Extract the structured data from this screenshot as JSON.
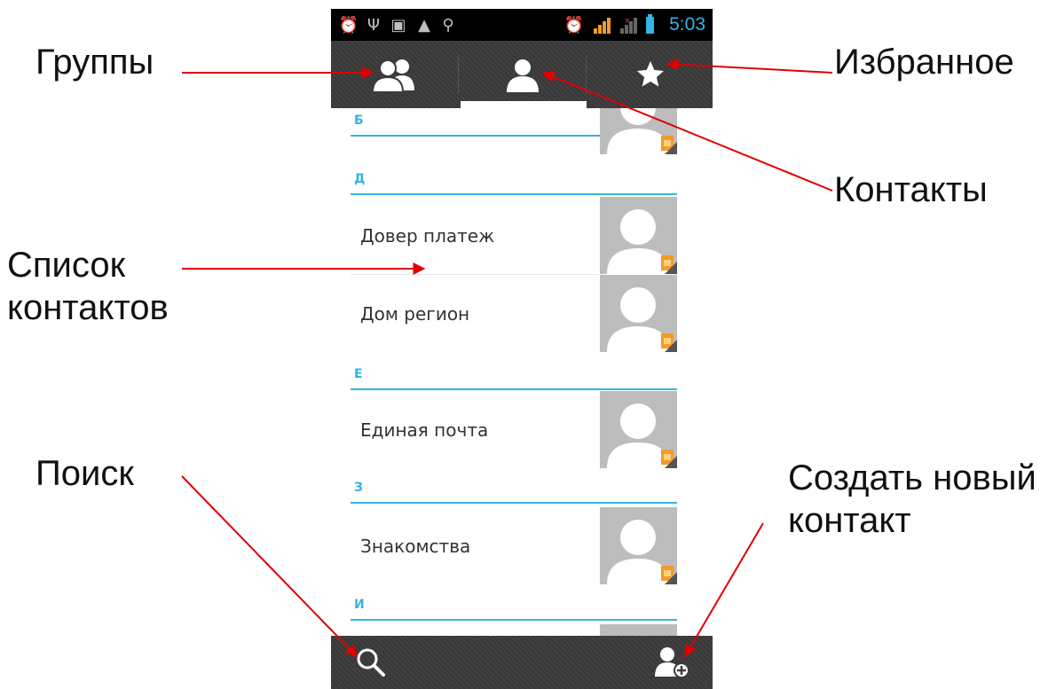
{
  "callouts": {
    "groups": "Группы",
    "favorites": "Избранное",
    "contacts": "Контакты",
    "contact_list_line1": "Список",
    "contact_list_line2": "контактов",
    "search": "Поиск",
    "new_contact_line1": "Создать новый",
    "new_contact_line2": "контакт"
  },
  "statusbar": {
    "time": "5:03",
    "icons": [
      "alarm-icon",
      "usb-icon",
      "image-icon",
      "warning-icon",
      "search-icon",
      "alarm-icon",
      "signal-icon",
      "signal-icon",
      "battery-icon"
    ]
  },
  "tabs": [
    {
      "name": "groups",
      "icon": "groups-icon"
    },
    {
      "name": "contacts",
      "icon": "person-icon",
      "selected": true
    },
    {
      "name": "favorites",
      "icon": "star-icon"
    }
  ],
  "sections": [
    {
      "letter": "Б",
      "contacts": []
    },
    {
      "letter": "Д",
      "contacts": [
        "Довер платеж",
        "Дом регион"
      ]
    },
    {
      "letter": "Е",
      "contacts": [
        "Единая почта"
      ]
    },
    {
      "letter": "З",
      "contacts": [
        "Знакомства"
      ]
    },
    {
      "letter": "И",
      "contacts": []
    }
  ],
  "bottombar": {
    "left_icon": "search-icon",
    "right_icon": "add-contact-icon"
  },
  "colors": {
    "accent": "#33b5e5",
    "bar_background": "#3b3b3b",
    "arrow": "#e00000",
    "sim_badge": "#f29b2a",
    "avatar_background": "#bdbdbd"
  }
}
